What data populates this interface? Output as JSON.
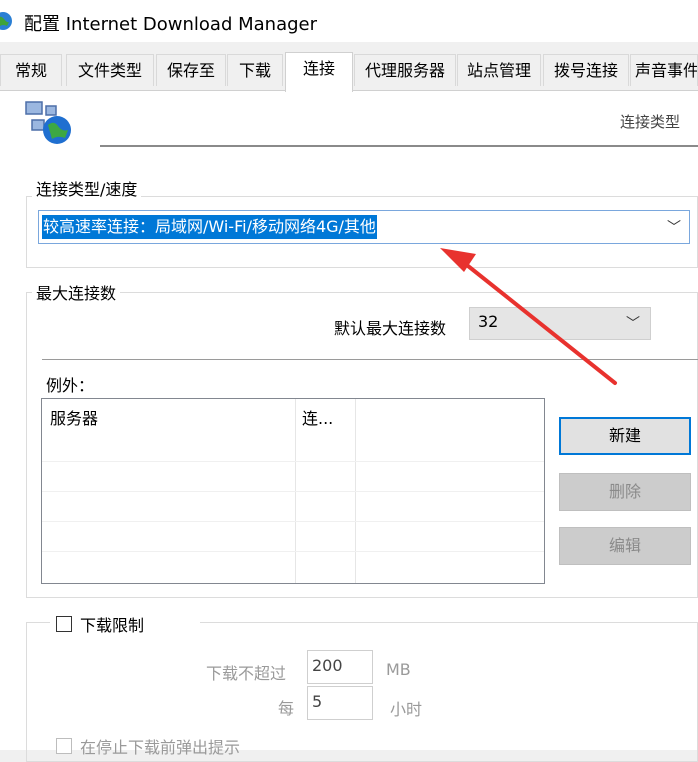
{
  "window": {
    "title": "配置 Internet Download Manager"
  },
  "tabs": [
    {
      "label": "常规"
    },
    {
      "label": "文件类型"
    },
    {
      "label": "保存至"
    },
    {
      "label": "下载"
    },
    {
      "label": "连接"
    },
    {
      "label": "代理服务器"
    },
    {
      "label": "站点管理"
    },
    {
      "label": "拨号连接"
    },
    {
      "label": "声音事件"
    }
  ],
  "header": {
    "label": "连接类型"
  },
  "connection_type": {
    "group_title": "连接类型/速度",
    "selected": "较高速率连接：局域网/Wi-Fi/移动网络4G/其他"
  },
  "max_connections": {
    "group_title": "最大连接数",
    "default_label": "默认最大连接数",
    "default_value": "32",
    "exceptions_label": "例外：",
    "columns": [
      "服务器",
      "连..."
    ],
    "buttons": {
      "new": "新建",
      "delete": "删除",
      "edit": "编辑"
    }
  },
  "download_limit": {
    "checkbox_label": "下载限制",
    "limit_label": "下载不超过",
    "limit_value": "200",
    "limit_unit": "MB",
    "per_label": "每",
    "per_value": "5",
    "per_unit": "小时",
    "popup_label": "在停止下载前弹出提示"
  },
  "colors": {
    "accent": "#0078d7",
    "annotation": "#e8322e"
  }
}
